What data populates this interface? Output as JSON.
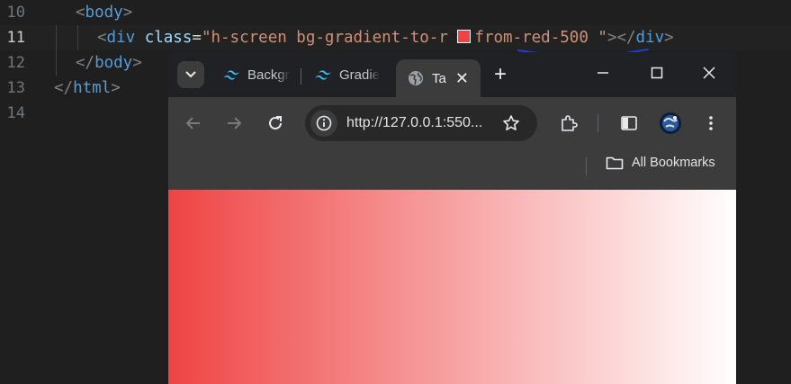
{
  "editor": {
    "lines": [
      {
        "num": "10",
        "indent": "    ",
        "parts": [
          [
            "tag",
            "<"
          ],
          [
            "tag",
            "body"
          ],
          [
            "tag",
            ">"
          ]
        ]
      },
      {
        "num": "11",
        "indent": "      ",
        "active": true
      },
      {
        "num": "12",
        "indent": "    ",
        "parts": [
          [
            "tag",
            "</"
          ],
          [
            "tag",
            "body"
          ],
          [
            "tag",
            ">"
          ]
        ]
      },
      {
        "num": "13",
        "indent": "  ",
        "parts": [
          [
            "tag",
            "</"
          ],
          [
            "tag",
            "html"
          ],
          [
            "tag",
            ">"
          ]
        ]
      },
      {
        "num": "14"
      }
    ],
    "line11": {
      "open_lt": "<",
      "tag": "div",
      "attr": "class",
      "eq": "=",
      "value_before": "\"h-screen bg-gradient-to-r ",
      "value_after": "from-red-500 \"",
      "close": "></",
      "close_tag": "div",
      "close_gt": ">"
    },
    "swatch_color": "#ef4444",
    "squiggle_color": "#1d3fd1"
  },
  "browser": {
    "tabs": [
      {
        "title": "Backgr",
        "icon": "tailwind-icon"
      },
      {
        "title": "Gradie",
        "icon": "tailwind-icon"
      },
      {
        "title": "Ta",
        "icon": "globe-icon",
        "active": true
      }
    ],
    "url": "http://127.0.0.1:550...",
    "bookmarks_label": "All Bookmarks",
    "gradient": {
      "from": "#ef4444",
      "to": "#ffffff",
      "direction": "to right"
    }
  }
}
